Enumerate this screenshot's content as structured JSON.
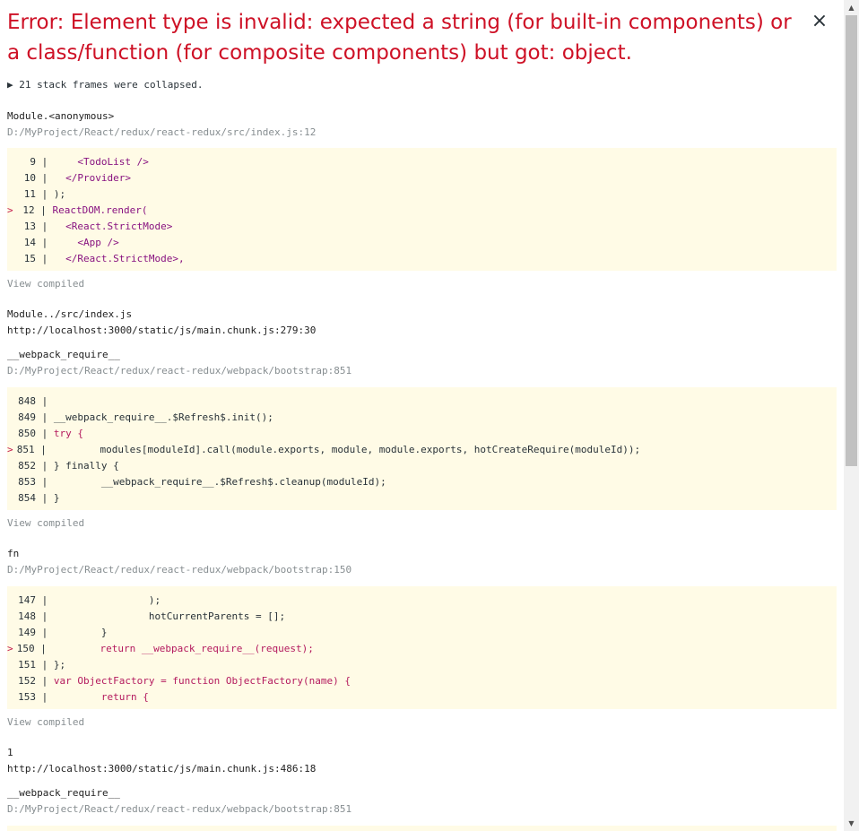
{
  "error": {
    "title": "Error: Element type is invalid: expected a string (for built-in components) or a class/function (for composite components) but got: object.",
    "close": "×",
    "collapsed": "▶ 21 stack frames were collapsed."
  },
  "frames": [
    {
      "fn": "Module.<anonymous>",
      "loc": "D:/MyProject/React/redux/react-redux/src/index.js:12",
      "view": "View compiled",
      "lines": [
        {
          "n": "9",
          "marker": "",
          "code": "    <TodoList />"
        },
        {
          "n": "10",
          "marker": "",
          "code": "  </Provider>"
        },
        {
          "n": "11",
          "marker": "",
          "code": ");"
        },
        {
          "n": "12",
          "marker": ">",
          "code": "ReactDOM.render("
        },
        {
          "n": "13",
          "marker": "",
          "code": "  <React.StrictMode>"
        },
        {
          "n": "14",
          "marker": "",
          "code": "    <App />"
        },
        {
          "n": "15",
          "marker": "",
          "code": "  </React.StrictMode>,"
        }
      ]
    },
    {
      "fn": "Module../src/index.js",
      "loc": "http://localhost:3000/static/js/main.chunk.js:279:30"
    },
    {
      "fn": "__webpack_require__",
      "loc": "D:/MyProject/React/redux/react-redux/webpack/bootstrap:851",
      "view": "View compiled",
      "lines": [
        {
          "n": "848",
          "marker": "",
          "code": ""
        },
        {
          "n": "849",
          "marker": "",
          "code": "__webpack_require__.$Refresh$.init();"
        },
        {
          "n": "850",
          "marker": "",
          "code": "try {"
        },
        {
          "n": "851",
          "marker": ">",
          "code": "        modules[moduleId].call(module.exports, module, module.exports, hotCreateRequire(moduleId));"
        },
        {
          "n": "852",
          "marker": "",
          "code": "} finally {"
        },
        {
          "n": "853",
          "marker": "",
          "code": "        __webpack_require__.$Refresh$.cleanup(moduleId);"
        },
        {
          "n": "854",
          "marker": "",
          "code": "}"
        }
      ]
    },
    {
      "fn": "fn",
      "loc": "D:/MyProject/React/redux/react-redux/webpack/bootstrap:150",
      "view": "View compiled",
      "lines": [
        {
          "n": "147",
          "marker": "",
          "code": "                );"
        },
        {
          "n": "148",
          "marker": "",
          "code": "                hotCurrentParents = [];"
        },
        {
          "n": "149",
          "marker": "",
          "code": "        }"
        },
        {
          "n": "150",
          "marker": ">",
          "code": "        return __webpack_require__(request);"
        },
        {
          "n": "151",
          "marker": "",
          "code": "};"
        },
        {
          "n": "152",
          "marker": "",
          "code": "var ObjectFactory = function ObjectFactory(name) {"
        },
        {
          "n": "153",
          "marker": "",
          "code": "        return {"
        }
      ]
    },
    {
      "fn": "1",
      "loc": "http://localhost:3000/static/js/main.chunk.js:486:18"
    },
    {
      "fn": "__webpack_require__",
      "loc": "D:/MyProject/React/redux/react-redux/webpack/bootstrap:851"
    }
  ],
  "scrollbar": {
    "up": "▲",
    "down": "▼"
  }
}
